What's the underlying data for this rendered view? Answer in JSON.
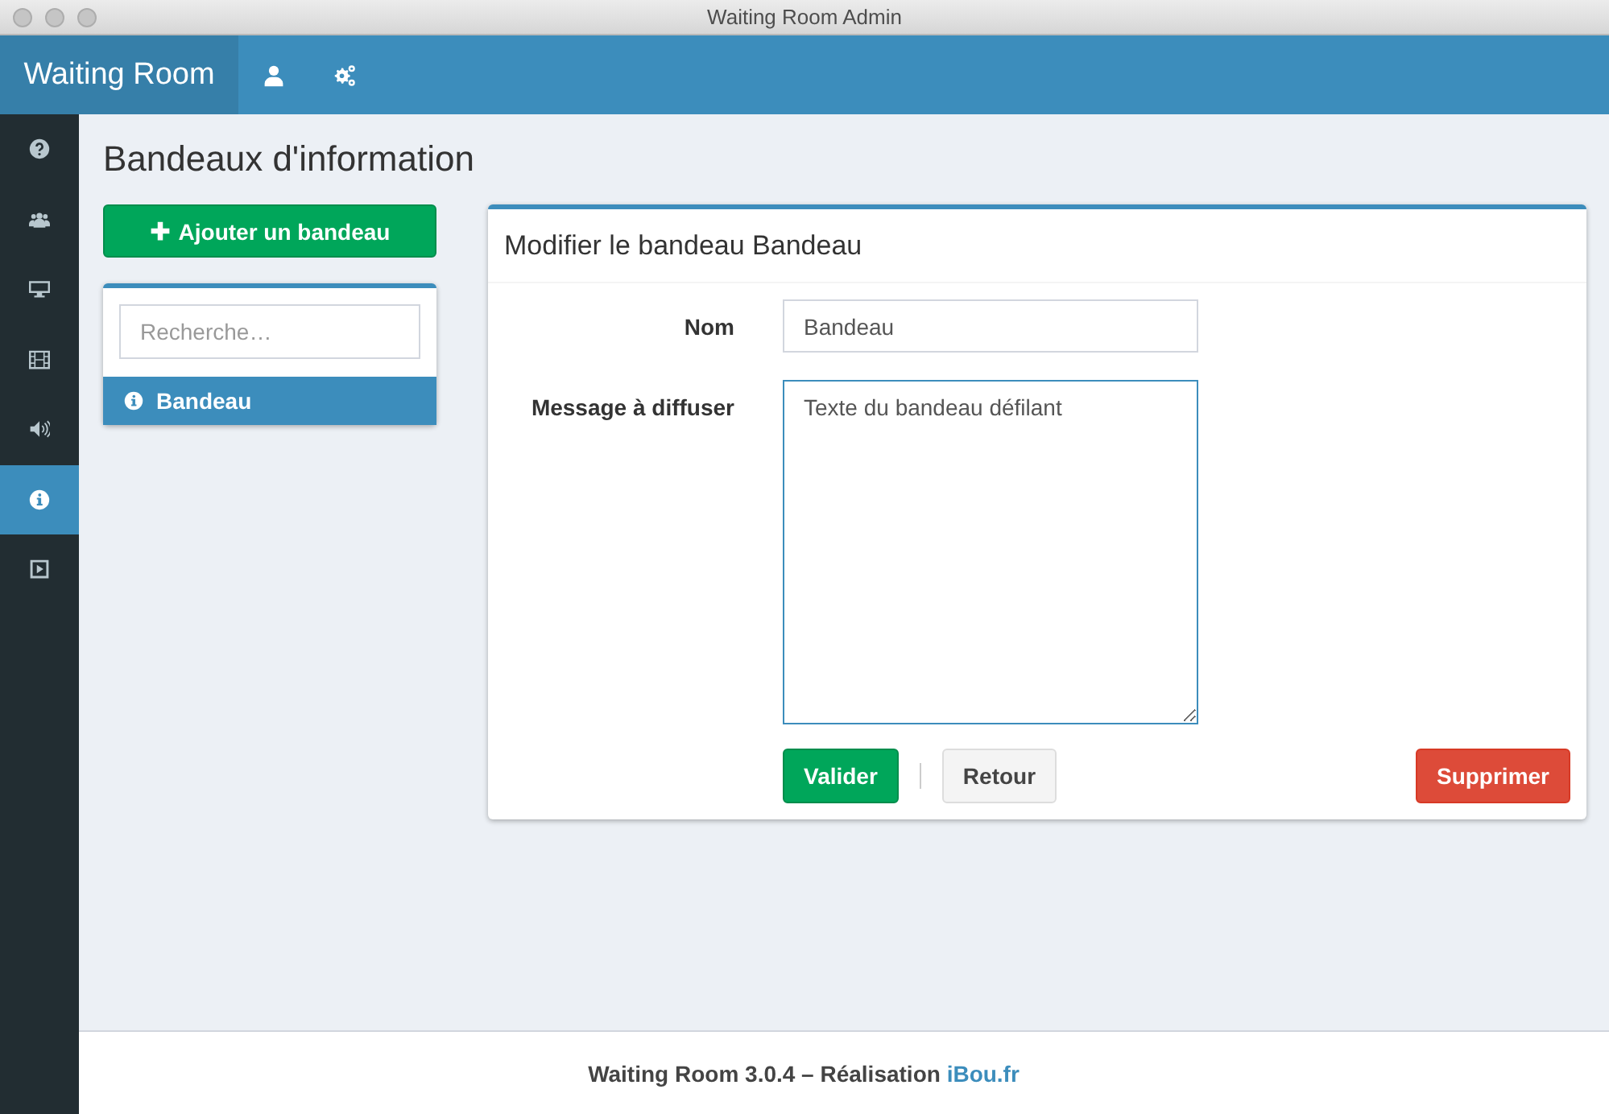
{
  "window": {
    "title": "Waiting Room Admin"
  },
  "navbar": {
    "brand": "Waiting Room",
    "icons": [
      {
        "kind": "user"
      },
      {
        "kind": "cogs"
      }
    ]
  },
  "sidebar": {
    "items": [
      {
        "kind": "help",
        "selected": false
      },
      {
        "kind": "users",
        "selected": false
      },
      {
        "kind": "desktop",
        "selected": false
      },
      {
        "kind": "film",
        "selected": false
      },
      {
        "kind": "volume",
        "selected": false
      },
      {
        "kind": "info",
        "selected": true
      },
      {
        "kind": "play",
        "selected": false
      }
    ]
  },
  "page": {
    "title": "Bandeaux d'information"
  },
  "add_button": {
    "label": "Ajouter un bandeau"
  },
  "search": {
    "placeholder": "Recherche…"
  },
  "list": {
    "items": [
      {
        "label": "Bandeau",
        "selected": true
      }
    ]
  },
  "form": {
    "title": "Modifier le bandeau Bandeau",
    "fields": [
      {
        "kind": "input",
        "label": "Nom",
        "value": "Bandeau"
      },
      {
        "kind": "textarea",
        "label": "Message à diffuser",
        "value": "Texte du bandeau défilant"
      }
    ],
    "buttons": [
      {
        "kind": "success",
        "label": "Valider"
      },
      {
        "kind": "default",
        "label": "Retour"
      },
      {
        "kind": "danger",
        "label": "Supprimer"
      }
    ]
  },
  "footer": {
    "text": "Waiting Room 3.0.4 – Réalisation",
    "link": "iBou.fr"
  }
}
